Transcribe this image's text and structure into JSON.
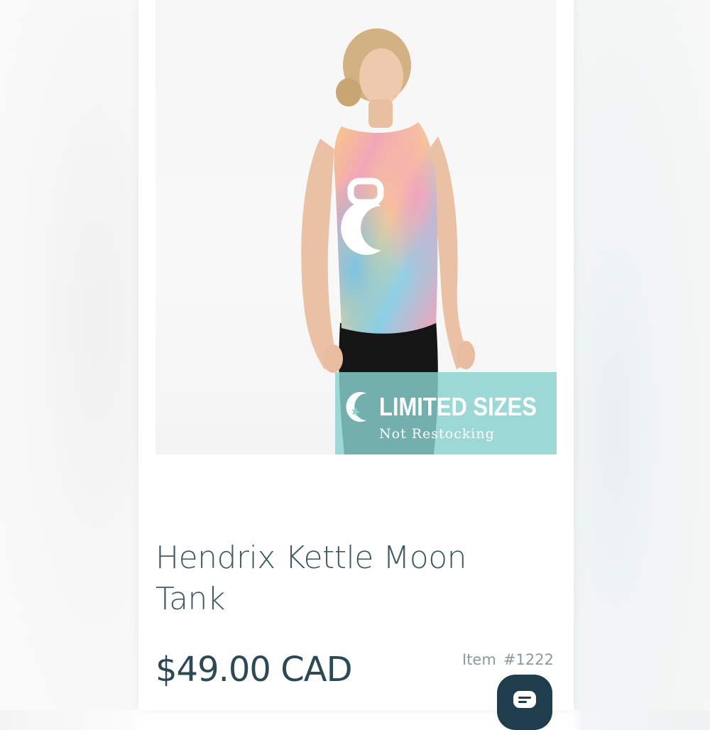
{
  "product": {
    "title": "Hendrix Kettle Moon Tank",
    "price": "$49.00 CAD",
    "item_label": "Item",
    "item_number": "#1222",
    "image_alt": "woman-wearing-tie-dye-tank"
  },
  "promo_badge": {
    "title": "LIMITED SIZES",
    "subtitle": "Not Restocking",
    "icon": "moon-icon",
    "color": "#88d2d0"
  },
  "chat_button": {
    "icon": "chat-icon",
    "color": "#1f3d4d"
  },
  "colors": {
    "title_text": "#3f5a63",
    "price_text": "#2c4a55",
    "item_text": "#8a9aa0"
  }
}
